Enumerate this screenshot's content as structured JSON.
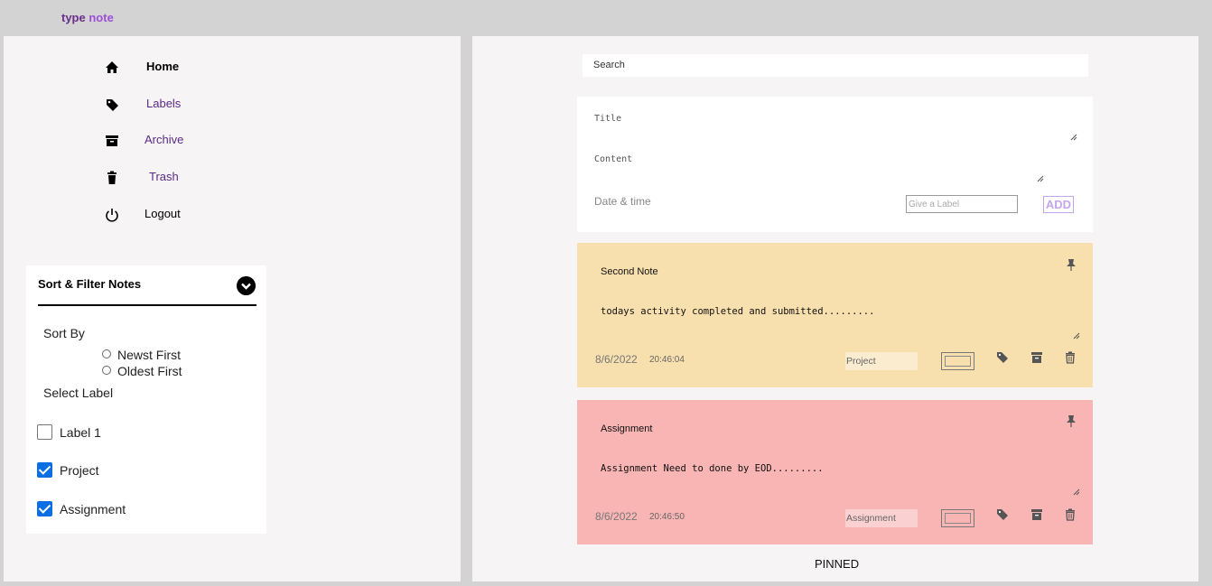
{
  "app": {
    "brand_part1": "type",
    "brand_part2": "note"
  },
  "nav": [
    {
      "label": "Home",
      "icon": "home-icon",
      "active": true
    },
    {
      "label": "Labels",
      "icon": "tag-icon"
    },
    {
      "label": "Archive",
      "icon": "archive-icon"
    },
    {
      "label": "Trash",
      "icon": "trash-icon"
    },
    {
      "label": "Logout",
      "icon": "power-icon"
    }
  ],
  "filter": {
    "title": "Sort & Filter Notes",
    "sort_by_label": "Sort By",
    "sort_options": [
      "Newst First",
      "Oldest First"
    ],
    "select_label": "Select Label",
    "labels": [
      {
        "name": "Label 1",
        "checked": false
      },
      {
        "name": "Project",
        "checked": true
      },
      {
        "name": "Assignment",
        "checked": true
      }
    ]
  },
  "search": {
    "placeholder": "Search"
  },
  "composer": {
    "title_placeholder": "Title",
    "content_placeholder": "Content",
    "date_placeholder": "Date & time",
    "label_placeholder": "Give a Label",
    "add_label": "ADD"
  },
  "notes": [
    {
      "title": "Second Note",
      "body": "todays activity completed and submitted.........",
      "date": "8/6/2022",
      "time": "20:46:04",
      "label": "Project",
      "color": "#f8dfae",
      "label_bg": "#fbebcf",
      "swatch": "#f8dfae"
    },
    {
      "title": "Assignment",
      "body": "Assignment Need to done by EOD.........",
      "date": "8/6/2022",
      "time": "20:46:50",
      "label": "Assignment",
      "color": "#f9b4b4",
      "label_bg": "#fbd0d0",
      "swatch": "#f9b4b4"
    }
  ],
  "section_label": "PINNED"
}
